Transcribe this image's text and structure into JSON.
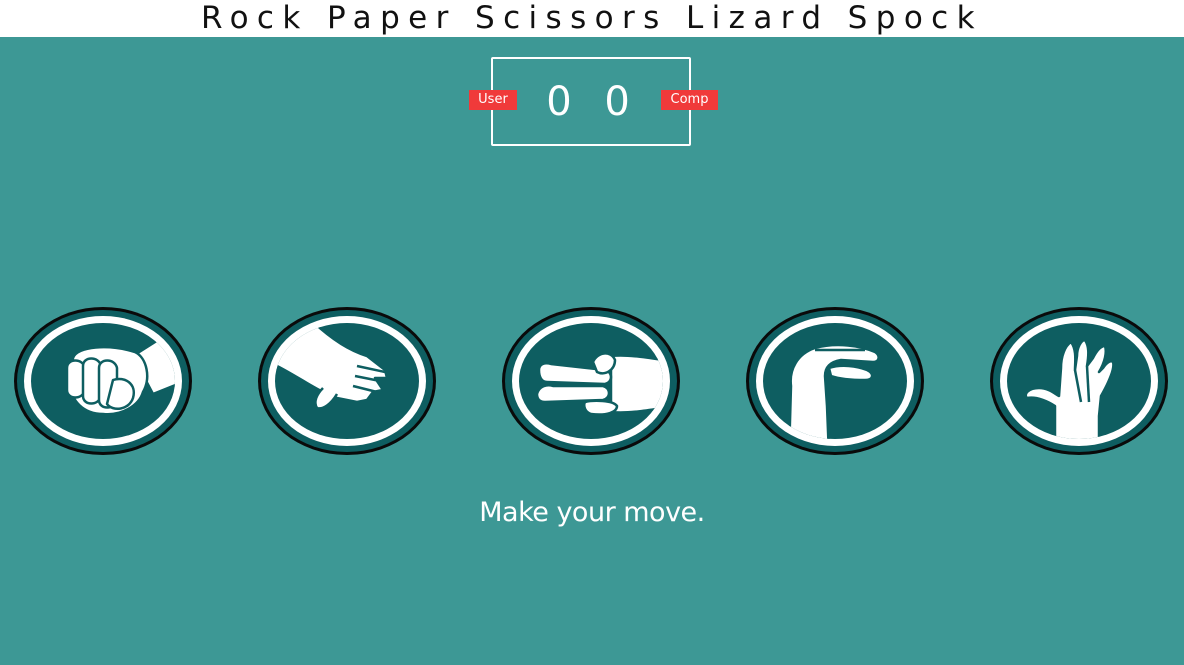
{
  "header": {
    "title": "Rock Paper Scissors Lizard Spock"
  },
  "scoreboard": {
    "user_label": "User",
    "comp_label": "Comp",
    "user_score": "0",
    "comp_score": "0",
    "score_display": "0 0"
  },
  "choices": [
    {
      "icon": "rock-hand-icon"
    },
    {
      "icon": "paper-hand-icon"
    },
    {
      "icon": "scissors-hand-icon"
    },
    {
      "icon": "lizard-hand-icon"
    },
    {
      "icon": "spock-hand-icon"
    }
  ],
  "status": {
    "message": "Make your move."
  },
  "colors": {
    "background": "#3d9895",
    "badge": "#f03a3a",
    "token_dark": "#0e5e61",
    "token_ring": "#ffffff",
    "token_outline": "#0a0a0a"
  }
}
